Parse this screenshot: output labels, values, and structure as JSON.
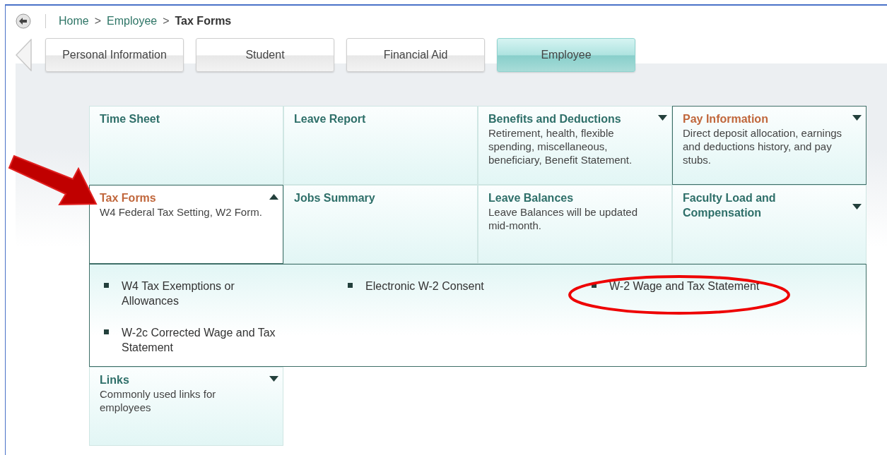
{
  "breadcrumb": {
    "links": [
      "Home",
      "Employee"
    ],
    "separators": [
      ">",
      ">"
    ],
    "current": "Tax Forms"
  },
  "tabs": [
    {
      "label": "Personal Information",
      "selected": false
    },
    {
      "label": "Student",
      "selected": false
    },
    {
      "label": "Financial Aid",
      "selected": false
    },
    {
      "label": "Employee",
      "selected": true
    }
  ],
  "tiles": [
    {
      "title": "Time Sheet",
      "has_menu": false,
      "selected": false,
      "expanded": false
    },
    {
      "title": "Leave Report",
      "has_menu": false,
      "selected": false,
      "expanded": false
    },
    {
      "title": "Benefits and Deductions",
      "description": "Retirement, health, flexible spending, miscellaneous, beneficiary, Benefit Statement.",
      "has_menu": true,
      "selected": false,
      "expanded": false
    },
    {
      "title": "Pay Information",
      "description": "Direct deposit allocation, earnings and deductions history, and pay stubs.",
      "has_menu": true,
      "selected": true,
      "expanded": false
    },
    {
      "title": "Tax Forms",
      "description": "W4 Federal Tax Setting, W2 Form.",
      "has_menu": true,
      "selected": true,
      "expanded": true,
      "children": [
        "W4 Tax Exemptions or Allowances",
        "Electronic W-2 Consent",
        "W-2 Wage and Tax Statement",
        "W-2c Corrected Wage and Tax Statement"
      ]
    },
    {
      "title": "Jobs Summary",
      "has_menu": false,
      "selected": false,
      "expanded": false
    },
    {
      "title": "Leave Balances",
      "description": "Leave Balances will be updated mid-month.",
      "has_menu": false,
      "selected": false,
      "expanded": false
    },
    {
      "title": "Faculty Load and Compensation",
      "has_menu": true,
      "selected": false,
      "expanded": false
    },
    {
      "title": "Links",
      "description": "Commonly used links for employees",
      "has_menu": true,
      "selected": false,
      "expanded": false
    }
  ]
}
